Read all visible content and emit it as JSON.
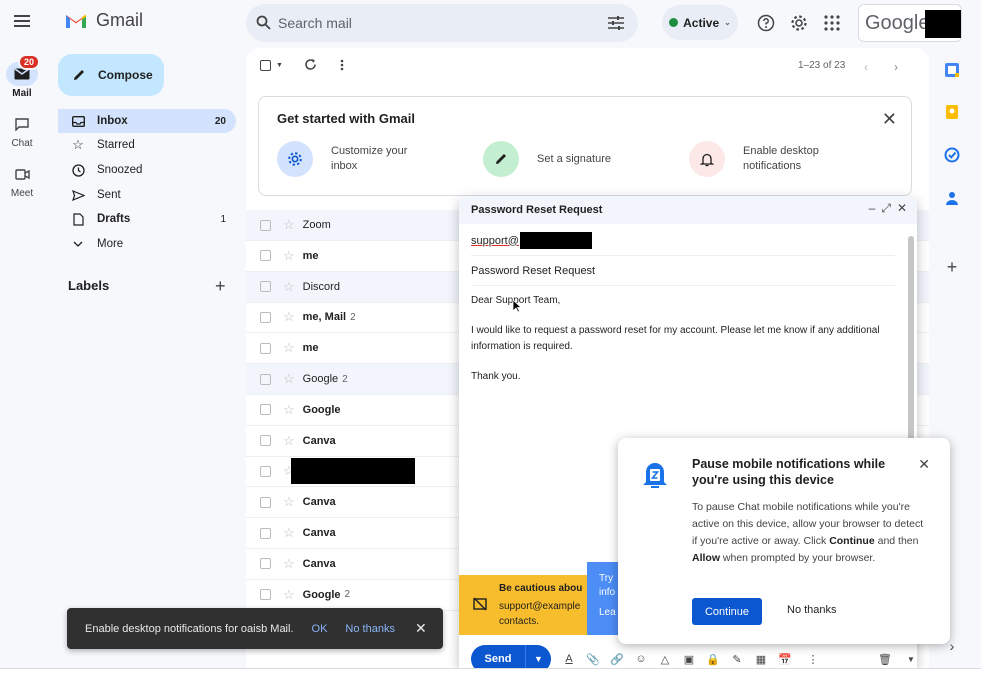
{
  "rail": {
    "mail": {
      "label": "Mail",
      "badge": "20"
    },
    "chat": {
      "label": "Chat"
    },
    "meet": {
      "label": "Meet"
    }
  },
  "header": {
    "brand": "Gmail",
    "search_placeholder": "Search mail",
    "status": "Active",
    "google_text": "Google"
  },
  "sidebar": {
    "compose": "Compose",
    "items": [
      {
        "label": "Inbox",
        "count": "20",
        "icon": "inbox-icon"
      },
      {
        "label": "Starred",
        "count": "",
        "icon": "star-icon"
      },
      {
        "label": "Snoozed",
        "count": "",
        "icon": "clock-icon"
      },
      {
        "label": "Sent",
        "count": "",
        "icon": "send-icon"
      },
      {
        "label": "Drafts",
        "count": "1",
        "icon": "draft-icon"
      },
      {
        "label": "More",
        "count": "",
        "icon": "chevron-down-icon"
      }
    ],
    "labels_heading": "Labels"
  },
  "toolbar": {
    "pager": "1–23 of 23"
  },
  "banner": {
    "title": "Get started with Gmail",
    "items": [
      {
        "label": "Customize your inbox"
      },
      {
        "label": "Set a signature"
      },
      {
        "label": "Enable desktop notifications"
      }
    ]
  },
  "emails": [
    {
      "sender": "Zoom",
      "count": "",
      "unread": false
    },
    {
      "sender": "me",
      "count": "",
      "unread": true
    },
    {
      "sender": "Discord",
      "count": "",
      "unread": false
    },
    {
      "sender": "me, Mail",
      "count": "2",
      "unread": true
    },
    {
      "sender": "me",
      "count": "",
      "unread": true
    },
    {
      "sender": "Google",
      "count": "2",
      "unread": false
    },
    {
      "sender": "Google",
      "count": "",
      "unread": true
    },
    {
      "sender": "Canva",
      "count": "",
      "unread": true
    },
    {
      "sender": "",
      "count": "",
      "unread": true
    },
    {
      "sender": "Canva",
      "count": "",
      "unread": true
    },
    {
      "sender": "Canva",
      "count": "",
      "unread": true
    },
    {
      "sender": "Canva",
      "count": "",
      "unread": true
    },
    {
      "sender": "Google",
      "count": "2",
      "unread": true
    }
  ],
  "compose_window": {
    "title": "Password Reset Request",
    "to": "support@",
    "subject": "Password Reset Request",
    "greeting": "Dear Support Team,",
    "body": "I would like to request a password reset for my account. Please let me know if any additional information is required.",
    "closing": "Thank you.",
    "warning_title": "Be cautious abou",
    "warning_text_1": "support@example",
    "warning_text_2": "contacts.",
    "try_text_1": "Try",
    "try_text_2": "info",
    "try_text_3": "Lea",
    "send": "Send"
  },
  "popup": {
    "title": "Pause mobile notifications while you're using this device",
    "body_1": "To pause Chat mobile notifications while you're active on this device, allow your browser to detect if you're active or away. Click ",
    "body_bold_1": "Continue",
    "body_2": " and then ",
    "body_bold_2": "Allow",
    "body_3": " when prompted by your browser.",
    "continue": "Continue",
    "no_thanks": "No thanks"
  },
  "snackbar": {
    "message": "Enable desktop notifications for oaisb Mail.",
    "ok": "OK",
    "no_thanks": "No thanks"
  },
  "colors": {
    "accent": "#0b57d0",
    "selected_nav": "#d3e3fd",
    "compose_button": "#c2e7ff",
    "warning": "#f8bd2d"
  }
}
